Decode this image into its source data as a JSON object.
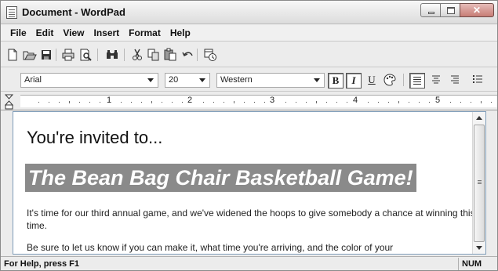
{
  "window": {
    "title": "Document - WordPad"
  },
  "menu": [
    "File",
    "Edit",
    "View",
    "Insert",
    "Format",
    "Help"
  ],
  "toolbar": {
    "buttons": [
      "new-icon",
      "open-icon",
      "save-icon",
      "print-icon",
      "print-preview-icon",
      "find-icon",
      "cut-icon",
      "copy-icon",
      "paste-icon",
      "undo-icon",
      "insert-date-time-icon"
    ]
  },
  "format_bar": {
    "font": "Arial",
    "size": "20",
    "script": "Western",
    "bold": "B",
    "italic": "I",
    "underline": "U"
  },
  "ruler": {
    "numbers": [
      "1",
      "2",
      "3",
      "4",
      "5"
    ]
  },
  "document": {
    "line1": "You're invited to...",
    "banner": "The Bean Bag Chair Basketball Game!",
    "para1": "It's time for our third annual game, and we've widened the hoops to give somebody a chance at winning this time.",
    "para2": "Be sure to let us know if you can make it, what time you're arriving, and the color of your"
  },
  "status": {
    "help": "For Help, press F1",
    "num": "NUM"
  }
}
